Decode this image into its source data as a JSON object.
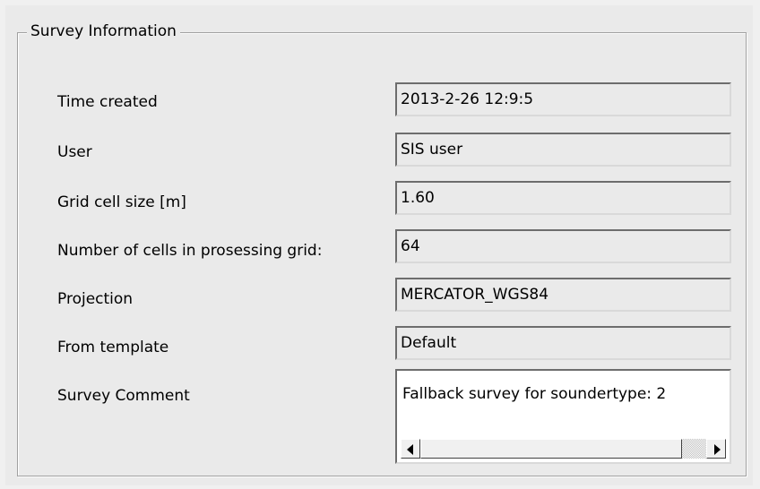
{
  "groupbox": {
    "title": "Survey Information"
  },
  "fields": [
    {
      "label": "Time created",
      "value": "2013-2-26 12:9:5"
    },
    {
      "label": "User",
      "value": "SIS user"
    },
    {
      "label": "Grid cell size [m]",
      "value": "1.60"
    },
    {
      "label": "Number of cells in prosessing grid:",
      "value": "64"
    },
    {
      "label": "Projection",
      "value": "MERCATOR_WGS84"
    },
    {
      "label": "From template",
      "value": "Default"
    }
  ],
  "comment": {
    "label": "Survey Comment",
    "value": "Fallback survey for soundertype: 2"
  },
  "scrollbar": {
    "left_icon": "scroll-left-arrow-icon",
    "right_icon": "scroll-right-arrow-icon"
  }
}
